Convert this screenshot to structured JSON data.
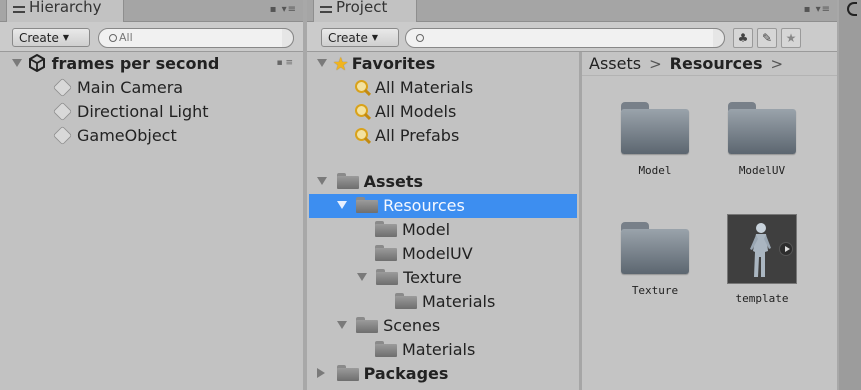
{
  "hierarchy": {
    "tab_label": "Hierarchy",
    "create_label": "Create",
    "search_placeholder": "All",
    "scene_name": "frames per second",
    "objects": [
      "Main Camera",
      "Directional Light",
      "GameObject"
    ]
  },
  "project": {
    "tab_label": "Project",
    "create_label": "Create",
    "search_placeholder": "",
    "favorites_label": "Favorites",
    "favorites": [
      "All Materials",
      "All Models",
      "All Prefabs"
    ],
    "assets_label": "Assets",
    "resources_label": "Resources",
    "resources_children": [
      "Model",
      "ModelUV",
      "Texture"
    ],
    "texture_child": "Materials",
    "scenes_label": "Scenes",
    "scenes_child": "Materials",
    "packages_label": "Packages",
    "breadcrumb": [
      "Assets",
      "Resources"
    ],
    "grid_items": [
      "Model",
      "ModelUV",
      "Texture",
      "template"
    ]
  },
  "colors": {
    "selection": "#3d8ef0",
    "panel": "#c2c2c2",
    "folder": "#6b747d"
  }
}
